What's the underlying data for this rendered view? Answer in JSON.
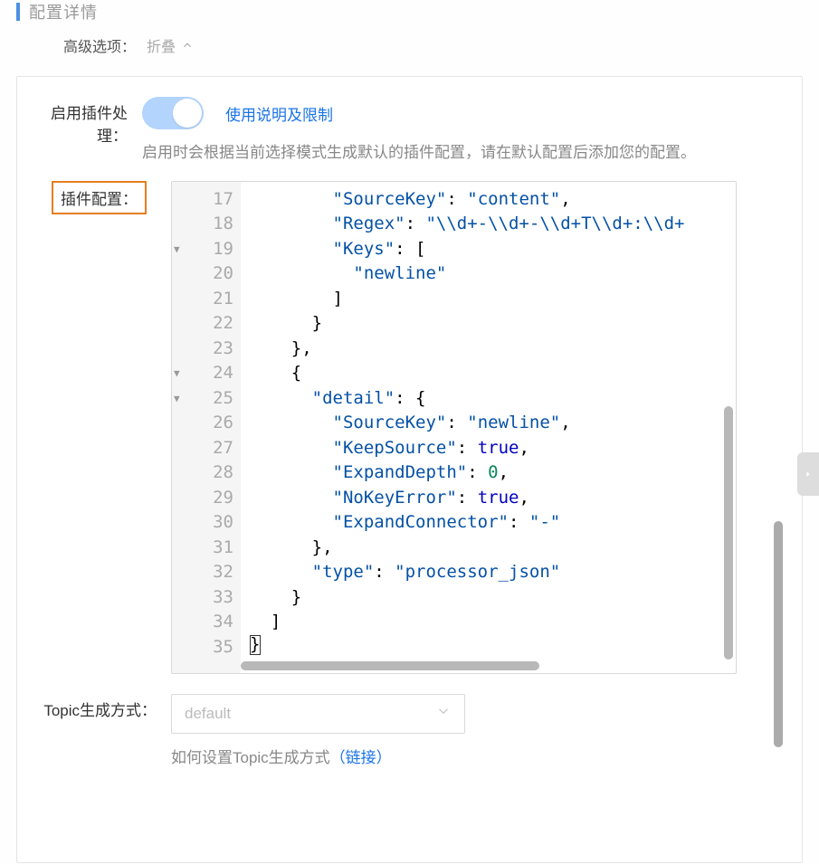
{
  "header": {
    "title": "配置详情",
    "adv_label": "高级选项：",
    "collapse_label": "折叠"
  },
  "plugin_toggle": {
    "label": "启用插件处理：",
    "link_text": "使用说明及限制",
    "help_text": "启用时会根据当前选择模式生成默认的插件配置，请在默认配置后添加您的配置。",
    "enabled": true
  },
  "plugin_config": {
    "label": "插件配置：",
    "line_start": 17,
    "lines": [
      {
        "n": 17,
        "indent": 8,
        "tokens": [
          {
            "t": "\"SourceKey\"",
            "c": "k"
          },
          {
            "t": ": ",
            "c": "p"
          },
          {
            "t": "\"content\"",
            "c": "s"
          },
          {
            "t": ",",
            "c": "p"
          }
        ]
      },
      {
        "n": 18,
        "indent": 8,
        "tokens": [
          {
            "t": "\"Regex\"",
            "c": "k"
          },
          {
            "t": ": ",
            "c": "p"
          },
          {
            "t": "\"\\\\d+-\\\\d+-\\\\d+T\\\\d+:\\\\d+",
            "c": "s"
          }
        ]
      },
      {
        "n": 19,
        "indent": 8,
        "fold": true,
        "tokens": [
          {
            "t": "\"Keys\"",
            "c": "k"
          },
          {
            "t": ": [",
            "c": "p"
          }
        ]
      },
      {
        "n": 20,
        "indent": 10,
        "tokens": [
          {
            "t": "\"newline\"",
            "c": "s"
          }
        ]
      },
      {
        "n": 21,
        "indent": 8,
        "tokens": [
          {
            "t": "]",
            "c": "p"
          }
        ]
      },
      {
        "n": 22,
        "indent": 6,
        "tokens": [
          {
            "t": "}",
            "c": "p"
          }
        ]
      },
      {
        "n": 23,
        "indent": 4,
        "tokens": [
          {
            "t": "},",
            "c": "p"
          }
        ]
      },
      {
        "n": 24,
        "indent": 4,
        "fold": true,
        "tokens": [
          {
            "t": "{",
            "c": "p"
          }
        ]
      },
      {
        "n": 25,
        "indent": 6,
        "fold": true,
        "tokens": [
          {
            "t": "\"detail\"",
            "c": "k"
          },
          {
            "t": ": {",
            "c": "p"
          }
        ]
      },
      {
        "n": 26,
        "indent": 8,
        "tokens": [
          {
            "t": "\"SourceKey\"",
            "c": "k"
          },
          {
            "t": ": ",
            "c": "p"
          },
          {
            "t": "\"newline\"",
            "c": "s"
          },
          {
            "t": ",",
            "c": "p"
          }
        ]
      },
      {
        "n": 27,
        "indent": 8,
        "tokens": [
          {
            "t": "\"KeepSource\"",
            "c": "k"
          },
          {
            "t": ": ",
            "c": "p"
          },
          {
            "t": "true",
            "c": "bool"
          },
          {
            "t": ",",
            "c": "p"
          }
        ]
      },
      {
        "n": 28,
        "indent": 8,
        "tokens": [
          {
            "t": "\"ExpandDepth\"",
            "c": "k"
          },
          {
            "t": ": ",
            "c": "p"
          },
          {
            "t": "0",
            "c": "n"
          },
          {
            "t": ",",
            "c": "p"
          }
        ]
      },
      {
        "n": 29,
        "indent": 8,
        "tokens": [
          {
            "t": "\"NoKeyError\"",
            "c": "k"
          },
          {
            "t": ": ",
            "c": "p"
          },
          {
            "t": "true",
            "c": "bool"
          },
          {
            "t": ",",
            "c": "p"
          }
        ]
      },
      {
        "n": 30,
        "indent": 8,
        "tokens": [
          {
            "t": "\"ExpandConnector\"",
            "c": "k"
          },
          {
            "t": ": ",
            "c": "p"
          },
          {
            "t": "\"-\"",
            "c": "s"
          }
        ]
      },
      {
        "n": 31,
        "indent": 6,
        "tokens": [
          {
            "t": "},",
            "c": "p"
          }
        ]
      },
      {
        "n": 32,
        "indent": 6,
        "tokens": [
          {
            "t": "\"type\"",
            "c": "k"
          },
          {
            "t": ": ",
            "c": "p"
          },
          {
            "t": "\"processor_json\"",
            "c": "s"
          }
        ]
      },
      {
        "n": 33,
        "indent": 4,
        "tokens": [
          {
            "t": "}",
            "c": "p"
          }
        ]
      },
      {
        "n": 34,
        "indent": 2,
        "tokens": [
          {
            "t": "]",
            "c": "p"
          }
        ]
      },
      {
        "n": 35,
        "indent": 0,
        "cursor": true,
        "tokens": []
      }
    ]
  },
  "topic": {
    "label": "Topic生成方式：",
    "select_value": "default",
    "help_prefix": "如何设置Topic生成方式",
    "help_link": "（链接）"
  }
}
